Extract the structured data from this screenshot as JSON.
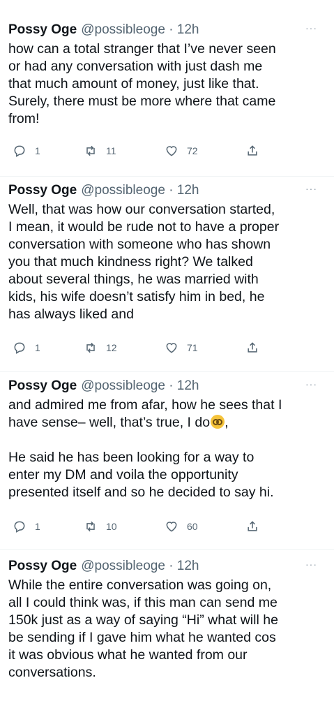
{
  "tweets": [
    {
      "name": "Possy Oge",
      "handle": "@possibleoge · 12h",
      "more": "···",
      "lines": [
        "how can a total stranger that I’ve never seen",
        "or had any conversation with just dash me",
        "that much amount of money, just like that.",
        "Surely, there must be more where that came",
        "from!"
      ],
      "replies": "1",
      "retweets": "11",
      "likes": "72"
    },
    {
      "name": "Possy Oge",
      "handle": "@possibleoge · 12h",
      "more": "···",
      "lines": [
        "Well, that was how our conversation started,",
        "I mean, it would be rude not to have a proper",
        "conversation with someone who has shown",
        "you that much kindness right? We talked",
        "about several things, he was married with",
        "kids, his wife doesn’t satisfy him in bed, he",
        "has always liked and"
      ],
      "replies": "1",
      "retweets": "12",
      "likes": "71"
    },
    {
      "name": "Possy Oge",
      "handle": "@possibleoge · 12h",
      "more": "···",
      "lines": [
        "and admired me from afar, how he sees that I",
        "have sense– well, that’s true, I do",
        "He said he has been looking for a way to",
        "enter my DM and voila the opportunity",
        "presented itself and so he decided to say hi."
      ],
      "emoji_suffix": ",",
      "replies": "1",
      "retweets": "10",
      "likes": "60"
    },
    {
      "name": "Possy Oge",
      "handle": "@possibleoge · 12h",
      "more": "···",
      "lines": [
        "While the entire conversation was going on,",
        "all I could think was, if this man can send me",
        "150k just as a way of saying “Hi” what will he",
        "be sending if I gave him what he wanted cos",
        "it was obvious what he wanted from our",
        "conversations."
      ]
    }
  ],
  "icons": {
    "reply": "reply-icon",
    "retweet": "retweet-icon",
    "like": "heart-icon",
    "share": "share-icon",
    "emoji": "nerd-face-emoji-icon"
  }
}
